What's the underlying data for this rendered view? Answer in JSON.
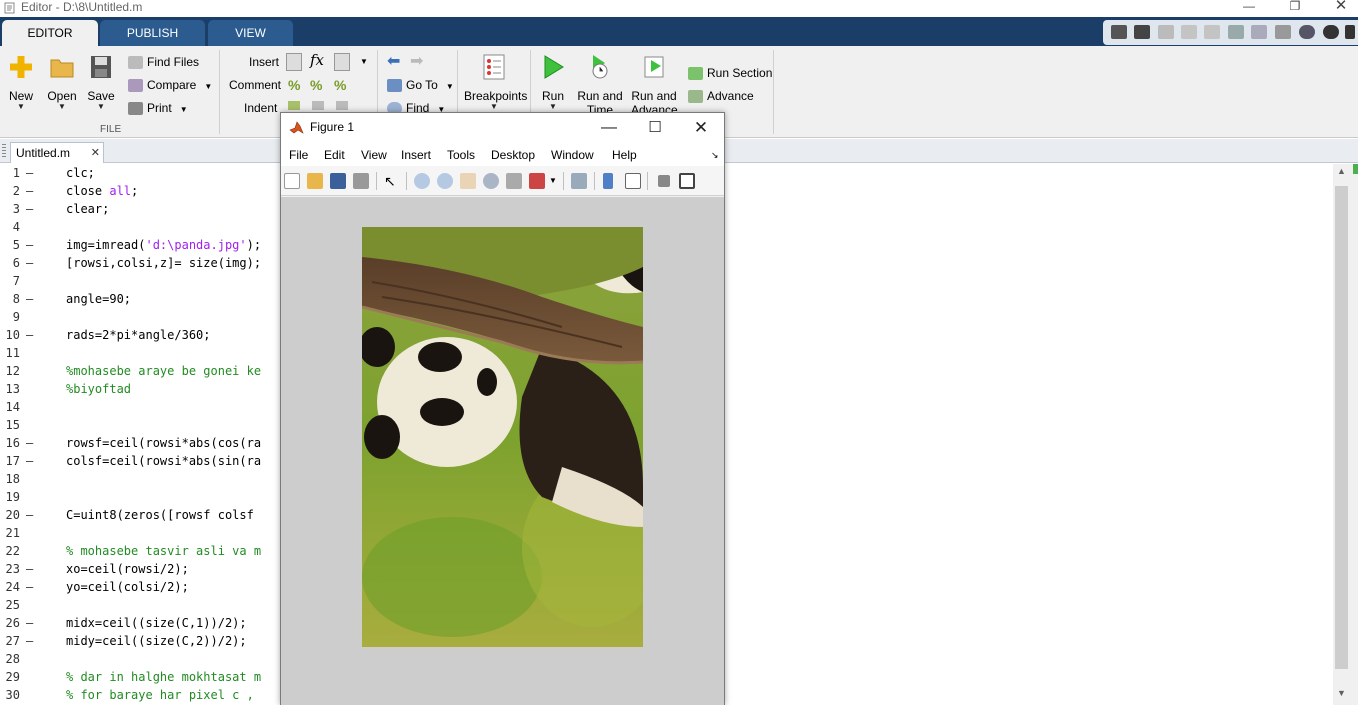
{
  "window": {
    "title": "Editor - D:\\8\\Untitled.m"
  },
  "tabs": [
    {
      "label": "EDITOR",
      "active": true
    },
    {
      "label": "PUBLISH",
      "active": false
    },
    {
      "label": "VIEW",
      "active": false
    }
  ],
  "ribbon": {
    "file": {
      "group_label": "FILE",
      "new": "New",
      "open": "Open",
      "save": "Save",
      "find_files": "Find Files",
      "compare": "Compare",
      "print": "Print"
    },
    "edit": {
      "insert": "Insert",
      "comment": "Comment",
      "indent": "Indent"
    },
    "navigate": {
      "go_to": "Go To",
      "find": "Find"
    },
    "breakpoints": {
      "label": "Breakpoints"
    },
    "run": {
      "run": "Run",
      "run_and_time": [
        "Run and",
        "Time"
      ],
      "run_and_advance": [
        "Run and",
        "Advance"
      ],
      "run_section": "Run Section",
      "advance": "Advance"
    }
  },
  "editor": {
    "file_tab": "Untitled.m",
    "lines": [
      {
        "n": "1",
        "dash": true,
        "parts": [
          [
            "clc;",
            ""
          ]
        ]
      },
      {
        "n": "2",
        "dash": true,
        "parts": [
          [
            "close ",
            ""
          ],
          [
            "all",
            "kw"
          ],
          [
            ";",
            ""
          ]
        ]
      },
      {
        "n": "3",
        "dash": true,
        "parts": [
          [
            "clear;",
            ""
          ]
        ]
      },
      {
        "n": "4",
        "dash": false,
        "parts": []
      },
      {
        "n": "5",
        "dash": true,
        "parts": [
          [
            "img=imread(",
            ""
          ],
          [
            "'d:\\panda.jpg'",
            "str"
          ],
          [
            ");",
            ""
          ]
        ]
      },
      {
        "n": "6",
        "dash": true,
        "parts": [
          [
            "[rowsi,colsi,z]= size(img);",
            ""
          ]
        ]
      },
      {
        "n": "7",
        "dash": false,
        "parts": []
      },
      {
        "n": "8",
        "dash": true,
        "parts": [
          [
            "angle=90;",
            ""
          ]
        ]
      },
      {
        "n": "9",
        "dash": false,
        "parts": []
      },
      {
        "n": "10",
        "dash": true,
        "parts": [
          [
            "rads=2*pi*angle/360;",
            ""
          ]
        ]
      },
      {
        "n": "11",
        "dash": false,
        "parts": []
      },
      {
        "n": "12",
        "dash": false,
        "parts": [
          [
            "%mohasebe araye be gonei ke",
            "comment"
          ]
        ]
      },
      {
        "n": "13",
        "dash": false,
        "parts": [
          [
            "%biyoftad",
            "comment"
          ]
        ]
      },
      {
        "n": "14",
        "dash": false,
        "parts": []
      },
      {
        "n": "15",
        "dash": false,
        "parts": []
      },
      {
        "n": "16",
        "dash": true,
        "parts": [
          [
            "rowsf=ceil(rowsi*abs(cos(ra",
            ""
          ]
        ]
      },
      {
        "n": "17",
        "dash": true,
        "parts": [
          [
            "colsf=ceil(rowsi*abs(sin(ra",
            ""
          ]
        ]
      },
      {
        "n": "18",
        "dash": false,
        "parts": []
      },
      {
        "n": "19",
        "dash": false,
        "parts": []
      },
      {
        "n": "20",
        "dash": true,
        "parts": [
          [
            "C=uint8(zeros([rowsf colsf",
            ""
          ]
        ]
      },
      {
        "n": "21",
        "dash": false,
        "parts": []
      },
      {
        "n": "22",
        "dash": false,
        "parts": [
          [
            "% mohasebe tasvir asli va m",
            "comment"
          ]
        ]
      },
      {
        "n": "23",
        "dash": true,
        "parts": [
          [
            "xo=ceil(rowsi/2);",
            ""
          ]
        ]
      },
      {
        "n": "24",
        "dash": true,
        "parts": [
          [
            "yo=ceil(colsi/2);",
            ""
          ]
        ]
      },
      {
        "n": "25",
        "dash": false,
        "parts": []
      },
      {
        "n": "26",
        "dash": true,
        "parts": [
          [
            "midx=ceil((size(C,1))/2);",
            ""
          ]
        ]
      },
      {
        "n": "27",
        "dash": true,
        "parts": [
          [
            "midy=ceil((size(C,2))/2);",
            ""
          ]
        ]
      },
      {
        "n": "28",
        "dash": false,
        "parts": []
      },
      {
        "n": "29",
        "dash": false,
        "parts": [
          [
            "% dar in halghe mokhtasat m",
            "comment"
          ]
        ]
      },
      {
        "n": "30",
        "dash": false,
        "parts": [
          [
            "% for baraye har pixel c ,",
            "comment"
          ]
        ]
      }
    ]
  },
  "figure": {
    "title": "Figure 1",
    "menu": [
      "File",
      "Edit",
      "View",
      "Insert",
      "Tools",
      "Desktop",
      "Window",
      "Help"
    ]
  },
  "colors": {
    "tabstrip": "#1a3e68",
    "tab": "#2b5b8f",
    "ribbon": "#f0f0f0",
    "comment": "#228B22",
    "string": "#a020f0"
  }
}
